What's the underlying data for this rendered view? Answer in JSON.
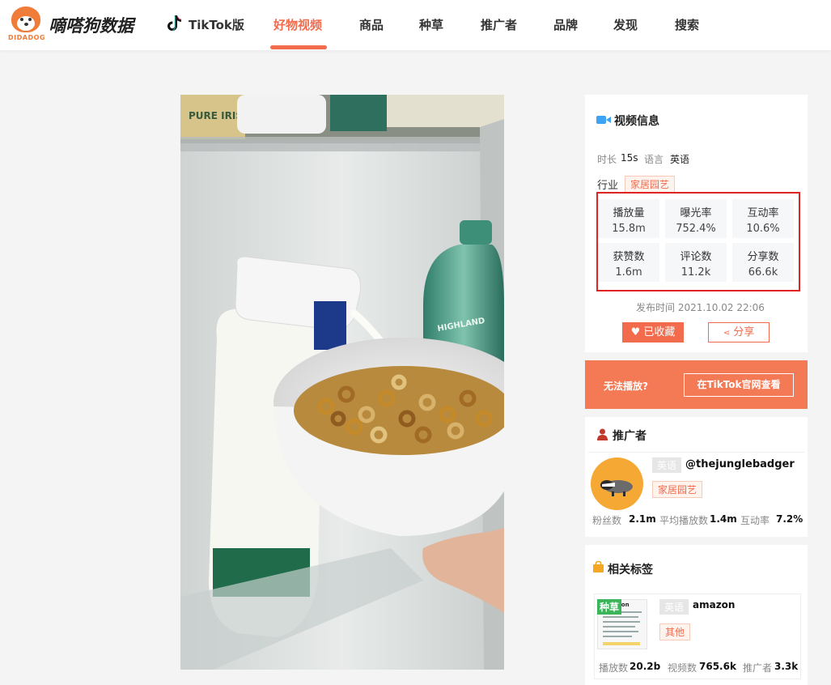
{
  "header": {
    "logo_text": "DIDADOG",
    "brand": "嘀嗒狗数据",
    "nav": [
      "TikTok版",
      "好物视频",
      "商品",
      "种草",
      "推广者",
      "品牌",
      "发现",
      "搜索"
    ],
    "active_nav": "好物视频"
  },
  "video_info": {
    "title": "视频信息",
    "duration_label": "时长",
    "duration": "15s",
    "language_label": "语言",
    "language": "英语",
    "industry_label": "行业",
    "industry": "家居园艺",
    "stats": [
      {
        "label": "播放量",
        "value": "15.8m"
      },
      {
        "label": "曝光率",
        "value": "752.4%"
      },
      {
        "label": "互动率",
        "value": "10.6%"
      },
      {
        "label": "获赞数",
        "value": "1.6m"
      },
      {
        "label": "评论数",
        "value": "11.2k"
      },
      {
        "label": "分享数",
        "value": "66.6k"
      }
    ],
    "publish_time": "发布时间 2021.10.02 22:06",
    "fav_button": "已收藏",
    "share_button": "分享"
  },
  "cta": {
    "text": "无法播放?",
    "button": "在TikTok官网查看"
  },
  "promoter": {
    "title": "推广者",
    "lang_tag": "英语",
    "handle": "@thejunglebadger",
    "industry_tag": "家居园艺",
    "fans_label": "粉丝数",
    "fans": "2.1m",
    "avg_play_label": "平均播放数",
    "avg_play": "1.4m",
    "engagement_label": "互动率",
    "engagement": "7.2%"
  },
  "tags": {
    "title": "相关标签",
    "badge": "种草",
    "lang_tag": "英语",
    "name": "amazon",
    "category_tag": "其他",
    "thumb_text": "azon",
    "plays_label": "播放数",
    "plays": "20.2b",
    "videos_label": "视频数",
    "videos": "765.6k",
    "promoters_label": "推广者",
    "promoters": "3.3k"
  },
  "video_overlay": {
    "label_text": "PURE IRISH",
    "bottle_text": "HIGHLAND"
  },
  "colors": {
    "accent": "#f26b4c",
    "highlight_border": "#e02424",
    "cta_bg": "#f47a55"
  }
}
